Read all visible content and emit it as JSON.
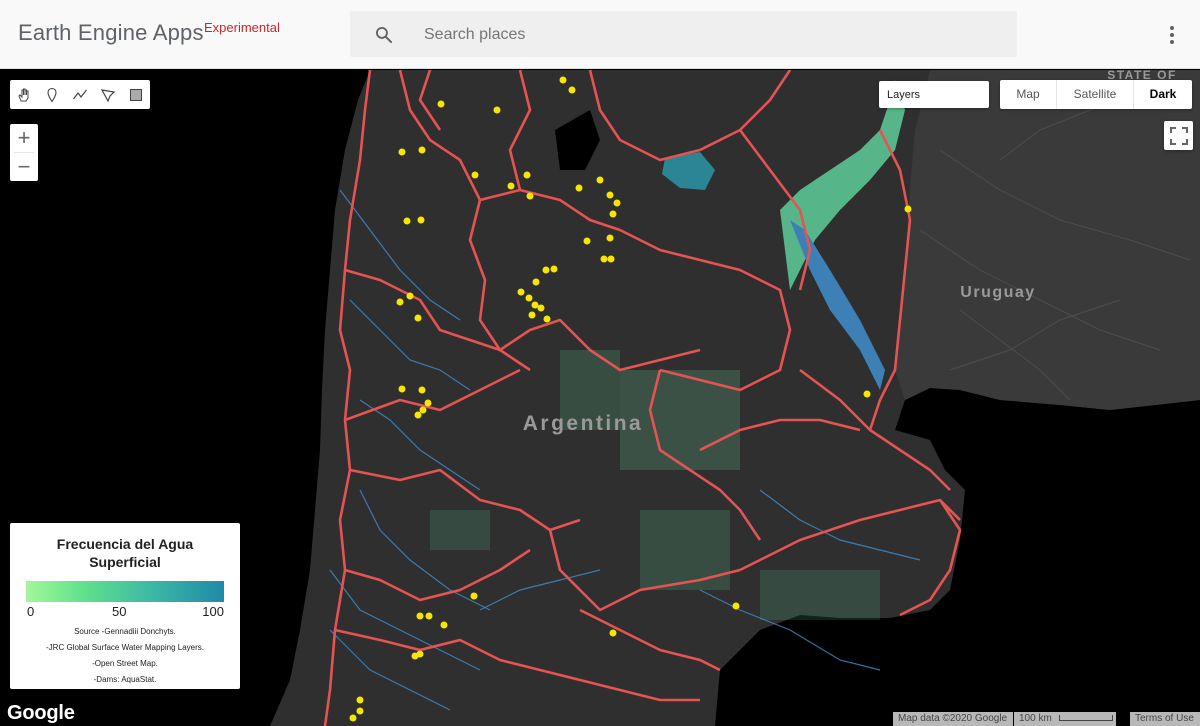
{
  "app": {
    "brand": "Earth Engine Apps",
    "badge": "Experimental"
  },
  "search": {
    "placeholder": "Search places"
  },
  "controls": {
    "layers_label": "Layers",
    "map_types": [
      "Map",
      "Satellite",
      "Dark"
    ],
    "active_map_type": "Dark",
    "zoom_in": "+",
    "zoom_out": "−",
    "draw_tools": [
      "hand-icon",
      "marker-icon",
      "line-icon",
      "polygon-icon",
      "rectangle-icon"
    ]
  },
  "map": {
    "labels": {
      "country_main": "Argentina",
      "country_east": "Uruguay",
      "state_fragment": "STATE OF"
    },
    "colors": {
      "background": "#303030",
      "ocean": "#000000",
      "boundary": "#e55353",
      "river": "#3f8fcf",
      "water_low": "#7be6a0",
      "water_high": "#1f8aa8",
      "dam": "#f7e600"
    }
  },
  "legend": {
    "title": "Frecuencia del Agua Superficial",
    "min": "0",
    "mid": "50",
    "max": "100",
    "sources": [
      "Source -Gennadiii Donchyts.",
      "-JRC Global Surface Water Mapping Layers.",
      "-Open Street Map.",
      "-Dams: AquaStat."
    ]
  },
  "footer": {
    "google": "Google",
    "map_data": "Map data ©2020 Google",
    "scale": "100 km",
    "terms": "Terms of Use"
  }
}
